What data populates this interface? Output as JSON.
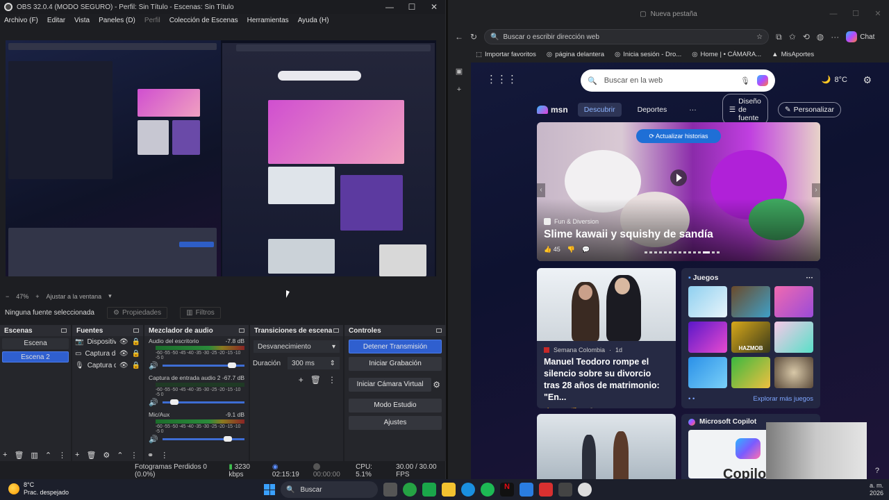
{
  "obs": {
    "window_title": "OBS 32.0.4 (MODO SEGURO) - Perfil: Sin Título - Escenas: Sin Título",
    "window_controls": [
      "—",
      "☐",
      "✕"
    ],
    "menu": [
      "Archivo (F)",
      "Editar",
      "Vista",
      "Paneles (D)",
      "Perfil",
      "Colección de Escenas",
      "Herramientas",
      "Ayuda (H)"
    ],
    "zoom": {
      "minus": "−",
      "value": "47%",
      "plus": "+",
      "fit": "Ajustar a la ventana"
    },
    "source_bar": {
      "no_source": "Ninguna fuente seleccionada",
      "properties": "Propiedades",
      "filters": "Filtros"
    },
    "scenes": {
      "title": "Escenas",
      "items": [
        "Escena",
        "Escena 2"
      ]
    },
    "sources": {
      "title": "Fuentes",
      "items": [
        "Dispositivo",
        "Captura de",
        "Captura de"
      ]
    },
    "mixer": {
      "title": "Mezclador de audio",
      "ticks": "-60 -55 -50 -45 -40 -35 -30 -25 -20 -15 -10 -5 0",
      "channels": [
        {
          "name": "Audio del escritorio",
          "db": "-7.8 dB",
          "level": 0.78,
          "volume": 0.9
        },
        {
          "name": "Captura de entrada audio 2",
          "db": "-67.7 dB",
          "level": 0.06,
          "volume": 0.2
        },
        {
          "name": "Mic/Aux",
          "db": "-9.1 dB",
          "level": 0.5,
          "volume": 0.85
        }
      ]
    },
    "transitions": {
      "title": "Transiciones de escena",
      "selected": "Desvanecimiento",
      "duration_label": "Duración",
      "duration_value": "300 ms"
    },
    "controls": {
      "title": "Controles",
      "stop_stream": "Detener Transmisión",
      "start_record": "Iniciar Grabación",
      "virtual_cam": "Iniciar Cámara Virtual",
      "studio_mode": "Modo Estudio",
      "settings": "Ajustes"
    },
    "status": {
      "dropped_frames": "Fotogramas Perdidos 0 (0.0%)",
      "bitrate": "3230 kbps",
      "stream_time": "02:15:19",
      "record_time": "00:00:00",
      "cpu": "CPU: 5.1%",
      "fps": "30.00 / 30.00 FPS"
    }
  },
  "browser": {
    "tab_title": "Nueva pestaña",
    "window_controls": [
      "—",
      "☐",
      "✕"
    ],
    "address_placeholder": "Buscar o escribir dirección web",
    "chat_label": "Chat",
    "favorites": [
      "Importar favoritos",
      "página delantera",
      "Inicia sesión - Dro...",
      "Home | • CÁMARA...",
      "MisAportes"
    ],
    "search_placeholder": "Buscar en la web",
    "weather": "8°C",
    "nav": {
      "logo": "msn",
      "discover": "Descubrir",
      "sports": "Deportes",
      "more": "···",
      "design": "Diseño de fuente",
      "personalize": "Personalizar"
    },
    "hero": {
      "pill": "Actualizar historias",
      "source": "Fun & Diversion",
      "title": "Slime kawaii y squishy de sandía",
      "likes": "45"
    },
    "news": {
      "source": "Semana Colombia",
      "age": "1d",
      "title": "Manuel Teodoro rompe el silencio sobre su divorcio tras 28 años de matrimonio: \"En...",
      "likes": "21",
      "comments": "1"
    },
    "games": {
      "title": "Juegos",
      "more": "···",
      "tile_label": "HAZMOB",
      "explore": "Explorar más juegos"
    },
    "copilot": {
      "title": "Microsoft Copilot",
      "word": "Copilot"
    }
  },
  "taskbar": {
    "temp": "8°C",
    "condition": "Prac. despejado",
    "search": "Buscar",
    "clock_line1": "a. m.",
    "clock_line2": "2026"
  }
}
